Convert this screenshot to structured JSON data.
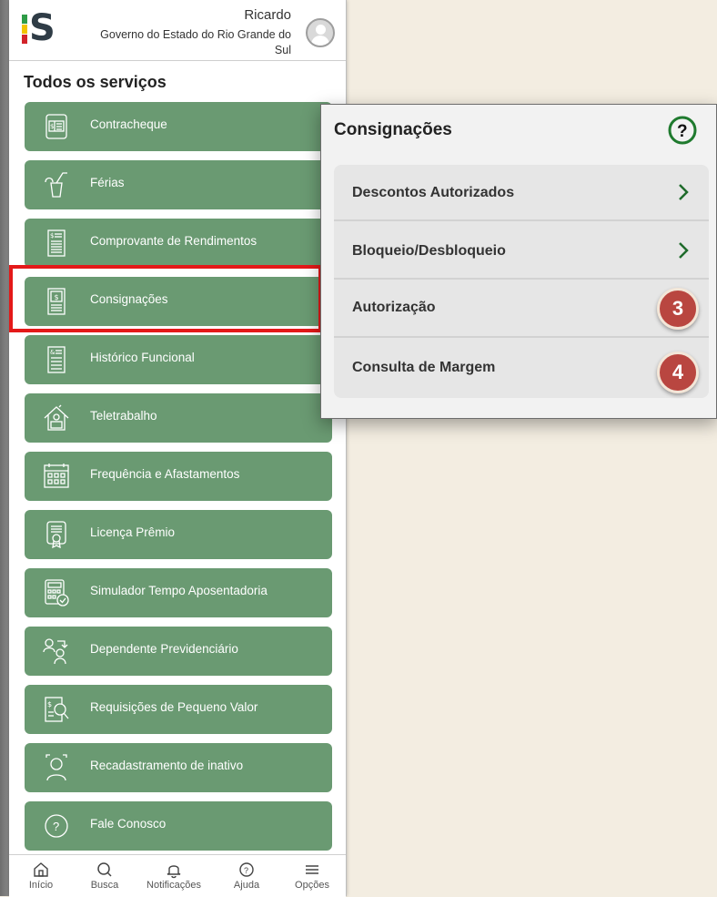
{
  "header": {
    "user_name": "Ricardo",
    "organization": "Governo do Estado do Rio Grande do Sul",
    "logo_letter": "S"
  },
  "section_title": "Todos os serviços",
  "services": [
    {
      "label": "Contracheque",
      "icon": "paycheck-icon"
    },
    {
      "label": "Férias",
      "icon": "beach-drink-icon"
    },
    {
      "label": "Comprovante de Rendimentos",
      "icon": "income-statement-icon"
    },
    {
      "label": "Consignações",
      "icon": "consignment-document-icon"
    },
    {
      "label": "Histórico Funcional",
      "icon": "history-document-icon"
    },
    {
      "label": "Teletrabalho",
      "icon": "home-office-icon"
    },
    {
      "label": "Frequência e Afastamentos",
      "icon": "calendar-grid-icon"
    },
    {
      "label": "Licença Prêmio",
      "icon": "award-certificate-icon"
    },
    {
      "label": "Simulador Tempo Aposentadoria",
      "icon": "calculator-check-icon"
    },
    {
      "label": "Dependente Previdenciário",
      "icon": "dependents-icon"
    },
    {
      "label": "Requisições de Pequeno Valor",
      "icon": "money-search-icon"
    },
    {
      "label": "Recadastramento de inativo",
      "icon": "face-scan-icon"
    },
    {
      "label": "Fale Conosco",
      "icon": "help-circle-icon"
    }
  ],
  "bottom_nav": [
    {
      "label": "Início",
      "icon": "home-icon"
    },
    {
      "label": "Busca",
      "icon": "search-icon"
    },
    {
      "label": "Notificações",
      "icon": "bell-icon"
    },
    {
      "label": "Ajuda",
      "icon": "help-icon"
    },
    {
      "label": "Opções",
      "icon": "menu-icon"
    }
  ],
  "popup": {
    "title": "Consignações",
    "items": [
      {
        "label": "Descontos Autorizados",
        "has_chevron": true
      },
      {
        "label": "Bloqueio/Desbloqueio",
        "has_chevron": true
      },
      {
        "label": "Autorização",
        "has_chevron": false
      },
      {
        "label": "Consulta de Margem",
        "has_chevron": false
      }
    ]
  },
  "badges": [
    "3",
    "4"
  ],
  "colors": {
    "service_green": "#6a9a72",
    "highlight_red": "#e41919",
    "badge_red": "#b94640",
    "help_green": "#1f7a2e"
  }
}
